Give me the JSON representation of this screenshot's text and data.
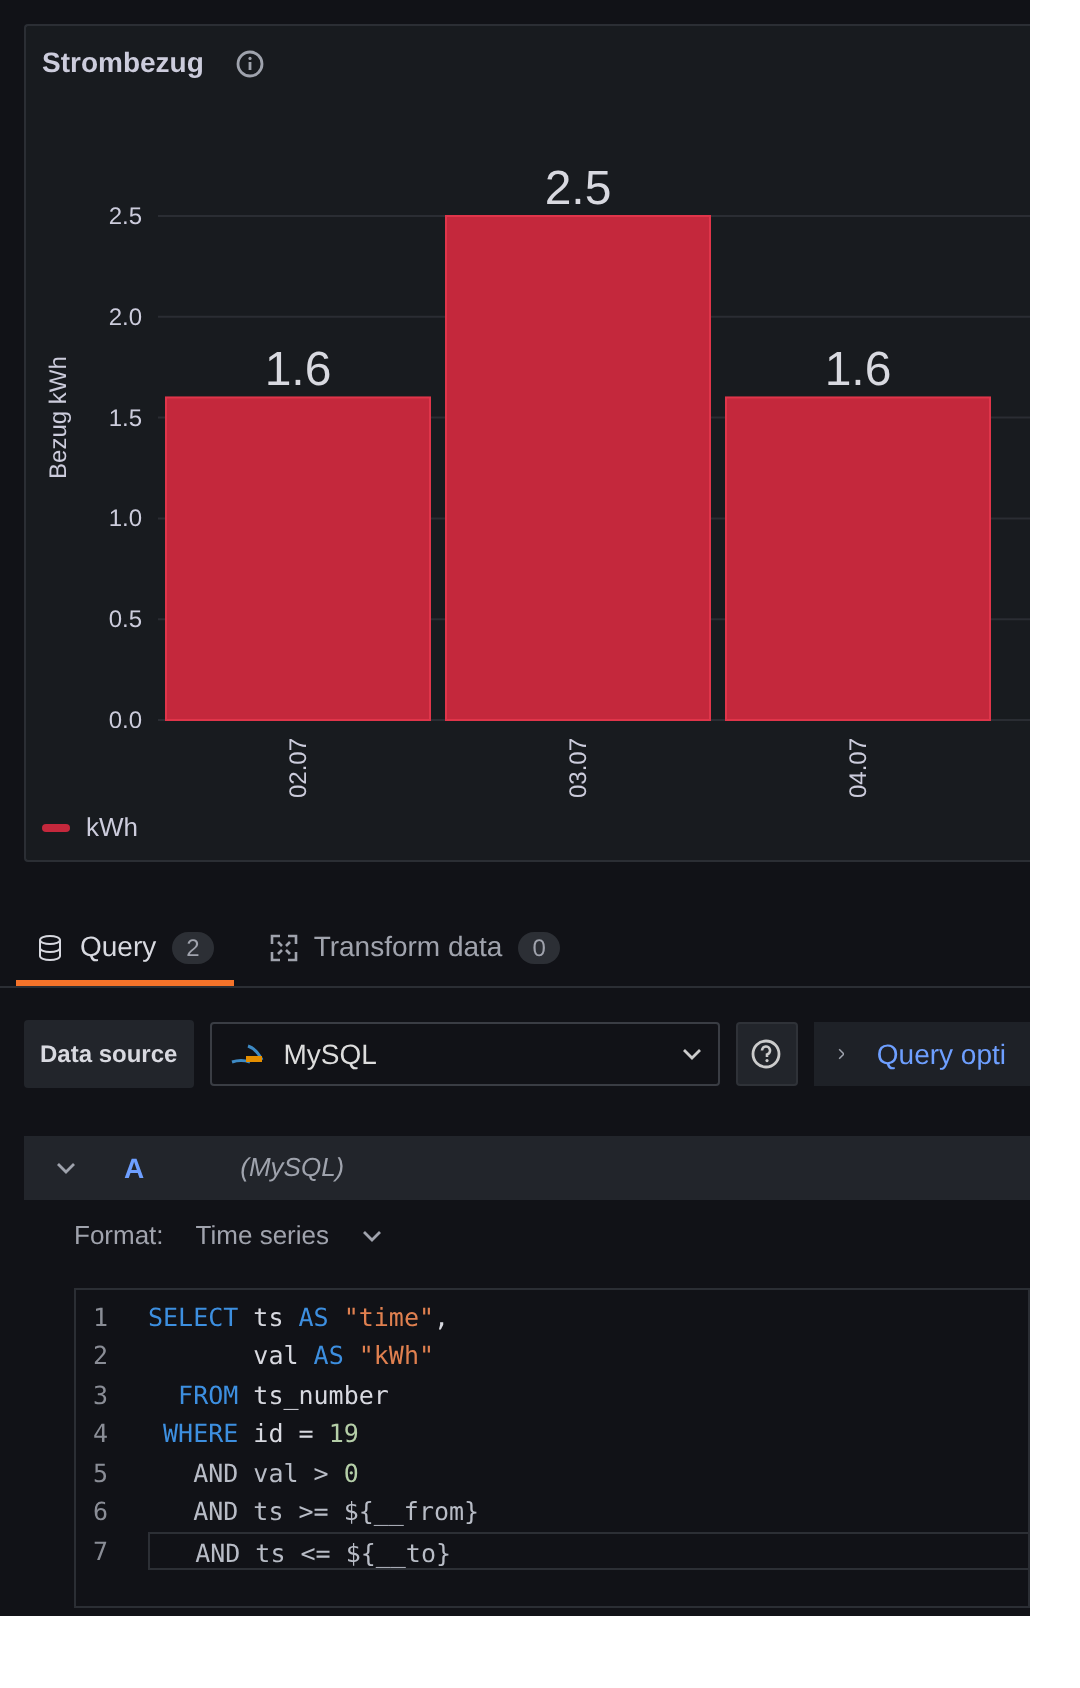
{
  "panel": {
    "title": "Strombezug",
    "chart_data": {
      "type": "bar",
      "ylabel": "Bezug kWh",
      "categories": [
        "02.07",
        "03.07",
        "04.07"
      ],
      "series": [
        {
          "name": "kWh",
          "color": "#c4283c",
          "values": [
            1.6,
            2.5,
            1.6
          ]
        }
      ],
      "yticks": [
        {
          "value": 0,
          "label": "0.0"
        },
        {
          "value": 0.5,
          "label": "0.5"
        },
        {
          "value": 1,
          "label": "1.0"
        },
        {
          "value": 1.5,
          "label": "1.5"
        },
        {
          "value": 2,
          "label": "2.0"
        },
        {
          "value": 2.5,
          "label": "2.5"
        }
      ],
      "ylim": [
        0,
        2.5
      ],
      "grid": true,
      "data_labels": true
    }
  },
  "tabs": [
    {
      "label": "Query",
      "count": "2",
      "selected": true,
      "kind": "query"
    },
    {
      "label": "Transform data",
      "count": "0",
      "selected": false,
      "kind": "transform"
    }
  ],
  "data_source": {
    "label": "Data source",
    "value": "MySQL",
    "query_options": "Query opti"
  },
  "query": {
    "ref": "A",
    "source": "(MySQL)",
    "format_label": "Format:",
    "format_value": "Time series",
    "lines": [
      {
        "number": "1",
        "tokens": [
          {
            "text": "SELECT",
            "kind": "kw"
          },
          {
            "text": " ts ",
            "kind": "id"
          },
          {
            "text": "AS",
            "kind": "kw"
          },
          {
            "text": " \"time\"",
            "kind": "str"
          },
          {
            "text": ",",
            "kind": "id"
          }
        ]
      },
      {
        "number": "2",
        "tokens": [
          {
            "text": "       val ",
            "kind": "id"
          },
          {
            "text": "AS",
            "kind": "kw"
          },
          {
            "text": " \"kWh\"",
            "kind": "str"
          }
        ]
      },
      {
        "number": "3",
        "tokens": [
          {
            "text": "  FROM",
            "kind": "kw"
          },
          {
            "text": " ts_number",
            "kind": "id"
          }
        ]
      },
      {
        "number": "4",
        "tokens": [
          {
            "text": " WHERE",
            "kind": "kw"
          },
          {
            "text": " id = ",
            "kind": "id"
          },
          {
            "text": "19",
            "kind": "num"
          }
        ]
      },
      {
        "number": "5",
        "tokens": [
          {
            "text": "   AND val > ",
            "kind": "op"
          },
          {
            "text": "0",
            "kind": "num"
          }
        ]
      },
      {
        "number": "6",
        "tokens": [
          {
            "text": "   AND ts >= ${__from}",
            "kind": "op"
          }
        ]
      },
      {
        "number": "7",
        "tokens": [
          {
            "text": "   AND ts <= ${__to}",
            "kind": "op"
          }
        ]
      }
    ]
  }
}
